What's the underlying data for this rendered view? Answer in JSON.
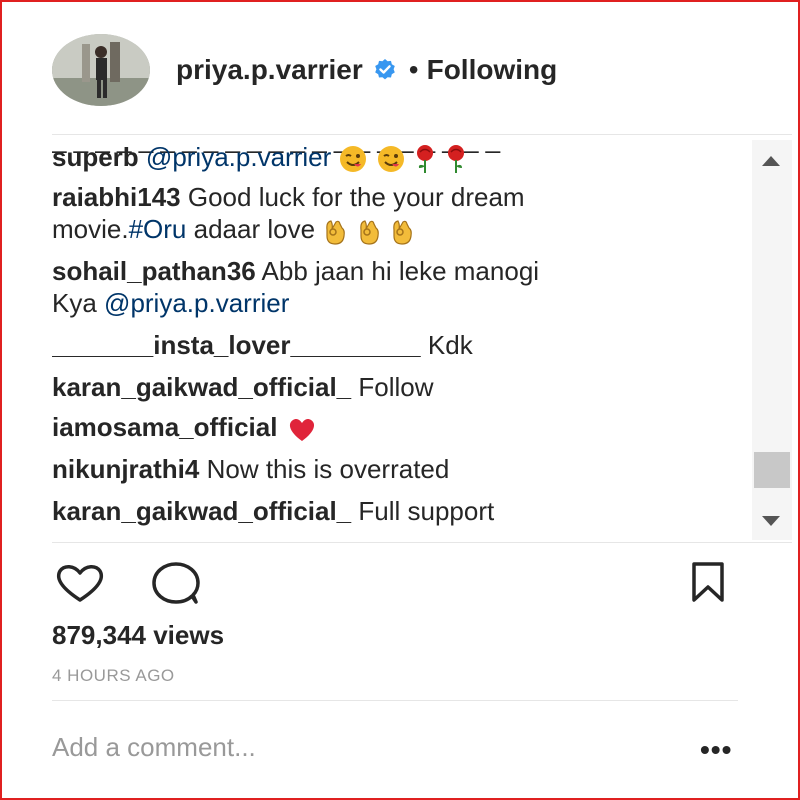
{
  "header": {
    "username": "priya.p.varrier",
    "separator": "•",
    "follow_status": "Following"
  },
  "comments": {
    "partial_top": "_ _  _ _ _  _  _  _ _  _ _ _ _ _ _  _ _ _ _ _  _",
    "items": [
      {
        "user": "superb",
        "text_link": "@priya.p.varrier",
        "emojis": [
          "winking-face",
          "winking-face",
          "rose",
          "rose"
        ]
      },
      {
        "user": "raiabhi143",
        "text1": "Good luck for the your dream",
        "text2_pre": "movie.",
        "hashtag": "#Oru",
        "text2_post": "adaar love",
        "emojis": [
          "ok-hand",
          "ok-hand",
          "ok-hand"
        ]
      },
      {
        "user": "sohail_pathan36",
        "text1": "Abb jaan hi leke manogi",
        "text2_pre": "Kya",
        "text_link": "@priya.p.varrier"
      },
      {
        "user": "_______insta_lover_________",
        "text": "Kdk"
      },
      {
        "user": "karan_gaikwad_official_",
        "text": "Follow"
      },
      {
        "user": "iamosama_official",
        "emojis": [
          "red-heart"
        ]
      },
      {
        "user": "nikunjrathi4",
        "text": "Now this is overrated"
      },
      {
        "user": "karan_gaikwad_official_",
        "text": "Full support"
      }
    ]
  },
  "actions": {
    "icons": [
      "heart-icon",
      "comment-icon",
      "bookmark-icon"
    ],
    "views": "879,344 views",
    "timestamp": "4 HOURS AGO"
  },
  "footer": {
    "comment_placeholder": "Add a comment...",
    "more_label": "•••"
  },
  "colors": {
    "text": "#262626",
    "link": "#003569",
    "muted": "#999999",
    "verified": "#3897f0",
    "frame": "#e02020"
  }
}
